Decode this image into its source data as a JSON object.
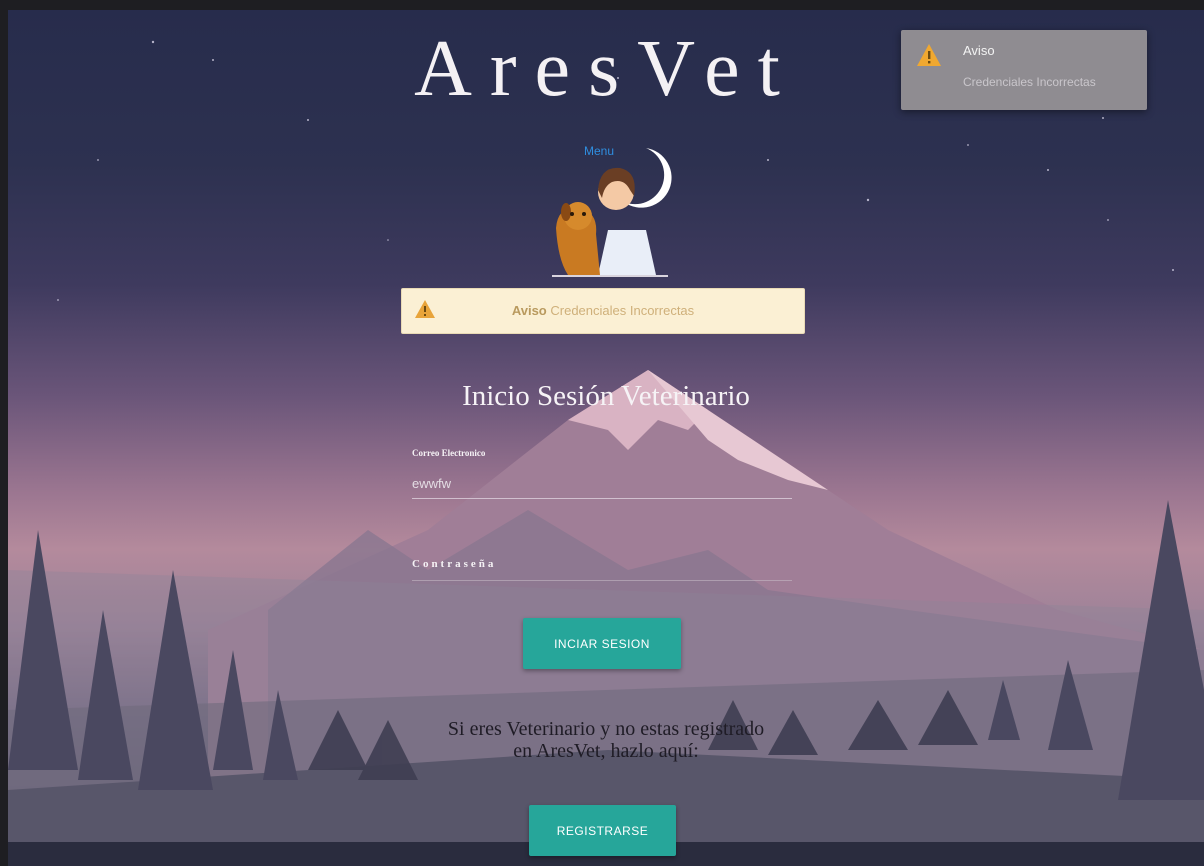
{
  "app": {
    "title": "AresVet"
  },
  "toast": {
    "title": "Aviso",
    "message": "Credenciales Incorrectas",
    "icon": "warning-icon"
  },
  "nav": {
    "menu_label": "Menu"
  },
  "alert": {
    "title": "Aviso",
    "message": "Credenciales Incorrectas",
    "icon": "warning-icon",
    "bg_color": "#fbf0d4"
  },
  "login": {
    "heading": "Inicio Sesión Veterinario",
    "email_label": "Correo Electronico",
    "email_value": "ewwfw",
    "password_label": "Contraseña",
    "password_value": "",
    "submit_label": "INCIAR SESION"
  },
  "register": {
    "text_line1": "Si eres Veterinario y no estas registrado",
    "text_line2": "en AresVet, hazlo aquí:",
    "button_label": "REGISTRARSE"
  },
  "colors": {
    "accent": "#26a69a",
    "link": "#2f8ee0"
  }
}
